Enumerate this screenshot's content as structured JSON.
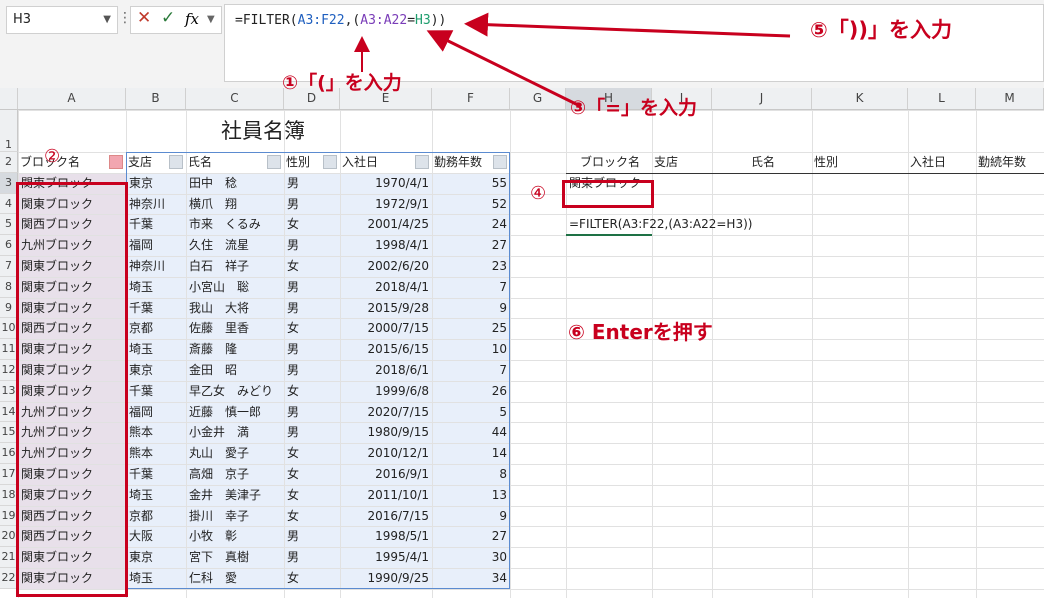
{
  "formula_bar": {
    "name_box": "H3",
    "fx": "fx",
    "formula_parts": [
      {
        "text": "=FILTER(",
        "color": "#222222"
      },
      {
        "text": "A3:F22",
        "color": "#1f5fbf"
      },
      {
        "text": ",(",
        "color": "#222222"
      },
      {
        "text": "A3:A22",
        "color": "#7a3db8"
      },
      {
        "text": "=",
        "color": "#222222"
      },
      {
        "text": "H3",
        "color": "#1f9e6e"
      },
      {
        "text": "))",
        "color": "#222222"
      }
    ]
  },
  "columns": [
    "A",
    "B",
    "C",
    "D",
    "E",
    "F",
    "G",
    "H",
    "I",
    "J",
    "K",
    "L",
    "M"
  ],
  "rows": [
    "1",
    "2",
    "3",
    "4",
    "5",
    "6",
    "7",
    "8",
    "9",
    "10",
    "11",
    "12",
    "13",
    "14",
    "15",
    "16",
    "17",
    "18",
    "19",
    "20",
    "21",
    "22"
  ],
  "sheet_title": "社員名簿",
  "table_headers": [
    "ブロック名",
    "支店",
    "氏名",
    "性別",
    "入社日",
    "勤務年数"
  ],
  "table_rows": [
    [
      "関東ブロック",
      "東京",
      "田中　稔",
      "男",
      "1970/4/1",
      "55"
    ],
    [
      "関東ブロック",
      "神奈川",
      "横爪　翔",
      "男",
      "1972/9/1",
      "52"
    ],
    [
      "関西ブロック",
      "千葉",
      "市来　くるみ",
      "女",
      "2001/4/25",
      "24"
    ],
    [
      "九州ブロック",
      "福岡",
      "久住　流星",
      "男",
      "1998/4/1",
      "27"
    ],
    [
      "関東ブロック",
      "神奈川",
      "白石　祥子",
      "女",
      "2002/6/20",
      "23"
    ],
    [
      "関東ブロック",
      "埼玉",
      "小宮山　聡",
      "男",
      "2018/4/1",
      "7"
    ],
    [
      "関東ブロック",
      "千葉",
      "我山　大将",
      "男",
      "2015/9/28",
      "9"
    ],
    [
      "関西ブロック",
      "京都",
      "佐藤　里香",
      "女",
      "2000/7/15",
      "25"
    ],
    [
      "関東ブロック",
      "埼玉",
      "斎藤　隆",
      "男",
      "2015/6/15",
      "10"
    ],
    [
      "関東ブロック",
      "東京",
      "金田　昭",
      "男",
      "2018/6/1",
      "7"
    ],
    [
      "関東ブロック",
      "千葉",
      "早乙女　みどり",
      "女",
      "1999/6/8",
      "26"
    ],
    [
      "九州ブロック",
      "福岡",
      "近藤　慎一郎",
      "男",
      "2020/7/15",
      "5"
    ],
    [
      "九州ブロック",
      "熊本",
      "小金井　満",
      "男",
      "1980/9/15",
      "44"
    ],
    [
      "九州ブロック",
      "熊本",
      "丸山　愛子",
      "女",
      "2010/12/1",
      "14"
    ],
    [
      "関東ブロック",
      "千葉",
      "高畑　京子",
      "女",
      "2016/9/1",
      "8"
    ],
    [
      "関東ブロック",
      "埼玉",
      "金井　美津子",
      "女",
      "2011/10/1",
      "13"
    ],
    [
      "関西ブロック",
      "京都",
      "掛川　幸子",
      "女",
      "2016/7/15",
      "9"
    ],
    [
      "関西ブロック",
      "大阪",
      "小牧　彰",
      "男",
      "1998/5/1",
      "27"
    ],
    [
      "関東ブロック",
      "東京",
      "宮下　真樹",
      "男",
      "1995/4/1",
      "30"
    ],
    [
      "関東ブロック",
      "埼玉",
      "仁科　愛",
      "女",
      "1990/9/25",
      "34"
    ]
  ],
  "result_headers": [
    "ブロック名",
    "支店",
    "氏名",
    "性別",
    "入社日",
    "勤続年数"
  ],
  "result_criteria": "関東ブロック",
  "result_formula": "=FILTER(A3:F22,(A3:A22=H3))",
  "annotations": {
    "a1": "①「(」を入力",
    "a2": "②",
    "a3": "③「=」を入力",
    "a4": "④",
    "a5": "⑤「))」を入力",
    "a6": "⑥ Enterを押す"
  },
  "colors": {
    "accent_red": "#c8001e",
    "header_bg": "#eef0f2",
    "range_blue": "#5b8bd0"
  }
}
